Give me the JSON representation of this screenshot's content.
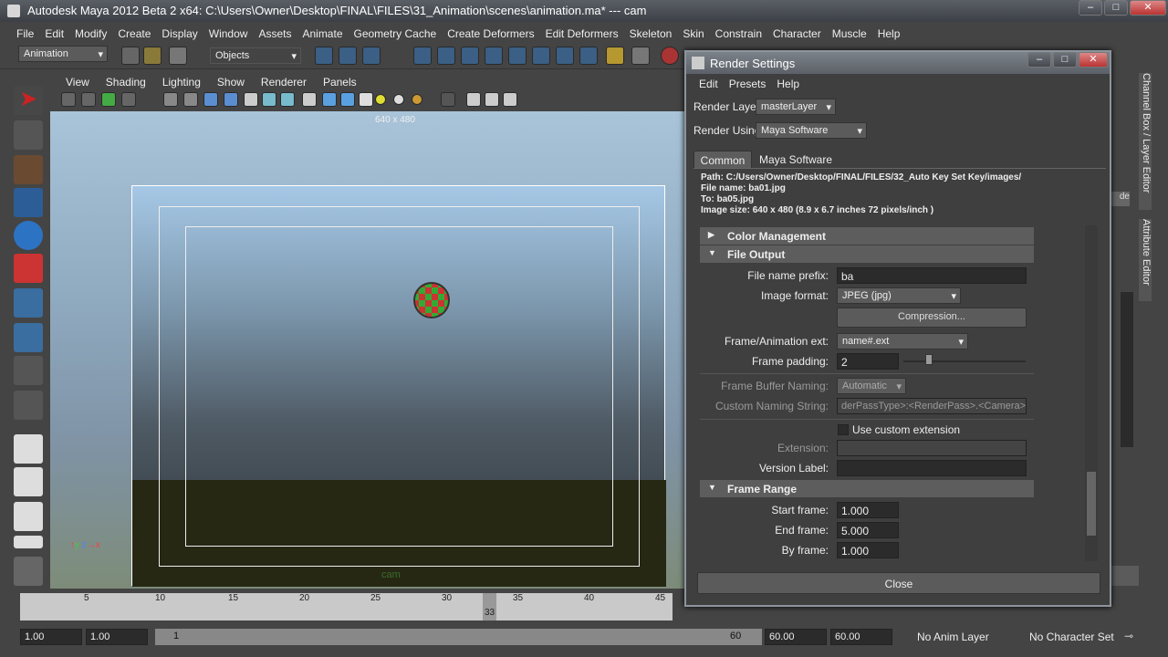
{
  "window": {
    "title": "Autodesk Maya 2012 Beta 2 x64: C:\\Users\\Owner\\Desktop\\FINAL\\FILES\\31_Animation\\scenes\\animation.ma*   ---   cam"
  },
  "menubar": [
    "File",
    "Edit",
    "Modify",
    "Create",
    "Display",
    "Window",
    "Assets",
    "Animate",
    "Geometry Cache",
    "Create Deformers",
    "Edit Deformers",
    "Skeleton",
    "Skin",
    "Constrain",
    "Character",
    "Muscle",
    "Help"
  ],
  "shelf": {
    "mode": "Animation",
    "objects": "Objects"
  },
  "viewport": {
    "menu": [
      "View",
      "Shading",
      "Lighting",
      "Show",
      "Renderer",
      "Panels"
    ],
    "resolution": "640 x 480",
    "camera": "cam"
  },
  "right_tabs": {
    "channel_box": "Channel Box / Layer Editor",
    "attribute_editor": "Attribute Editor",
    "de": "de"
  },
  "render_settings": {
    "title": "Render Settings",
    "menu": [
      "Edit",
      "Presets",
      "Help"
    ],
    "render_layer_label": "Render Layer",
    "render_layer": "masterLayer",
    "render_using_label": "Render Using",
    "render_using": "Maya Software",
    "tabs": [
      "Common",
      "Maya Software"
    ],
    "info": {
      "path": "Path: C:/Users/Owner/Desktop/FINAL/FILES/32_Auto Key Set Key/images/",
      "file_name": "File name:  ba01.jpg",
      "to": "To:           ba05.jpg",
      "image_size": "Image size: 640 x 480 (8.9 x 6.7 inches 72 pixels/inch )"
    },
    "sections": {
      "color_mgmt": "Color Management",
      "file_output": "File Output",
      "frame_range": "Frame Range"
    },
    "file_output": {
      "prefix_label": "File name prefix:",
      "prefix": "ba",
      "format_label": "Image format:",
      "format": "JPEG (jpg)",
      "compression": "Compression...",
      "ext_label": "Frame/Animation ext:",
      "ext": "name#.ext",
      "padding_label": "Frame padding:",
      "padding": "2",
      "fb_label": "Frame Buffer Naming:",
      "fb": "Automatic",
      "custom_label": "Custom Naming String:",
      "custom": "derPassType>:<RenderPass>.<Camera>",
      "use_custom": "Use custom extension",
      "extension_label": "Extension:",
      "version_label": "Version Label:"
    },
    "frame_range": {
      "start_label": "Start frame:",
      "start": "1.000",
      "end_label": "End frame:",
      "end": "5.000",
      "by_label": "By frame:",
      "by": "1.000"
    },
    "close": "Close"
  },
  "timeline": {
    "ticks": [
      "5",
      "10",
      "15",
      "20",
      "25",
      "30",
      "35",
      "40",
      "45"
    ],
    "current": "33"
  },
  "range": {
    "start": "1.00",
    "start2": "1.00",
    "slider_start": "1",
    "slider_end": "60",
    "end": "60.00",
    "end2": "60.00",
    "anim_layer": "No Anim Layer",
    "char_set": "No Character Set"
  }
}
